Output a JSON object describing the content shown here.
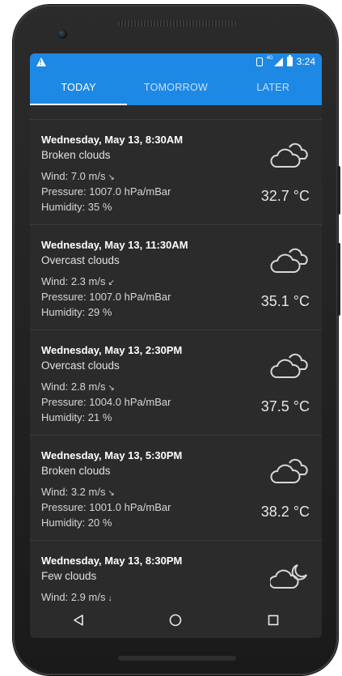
{
  "status": {
    "time": "3:24",
    "network": "4G"
  },
  "tabs": [
    {
      "label": "TODAY",
      "active": true
    },
    {
      "label": "TOMORROW",
      "active": false
    },
    {
      "label": "LATER",
      "active": false
    }
  ],
  "forecasts": [
    {
      "date": "Wednesday, May 13, 8:30AM",
      "description": "Broken clouds",
      "wind": "Wind: 7.0 m/s",
      "wind_dir": "↘",
      "pressure": "Pressure: 1007.0 hPa/mBar",
      "humidity": "Humidity: 35 %",
      "temperature": "32.7 °C",
      "icon": "broken-clouds-icon"
    },
    {
      "date": "Wednesday, May 13, 11:30AM",
      "description": "Overcast clouds",
      "wind": "Wind: 2.3 m/s",
      "wind_dir": "↙",
      "pressure": "Pressure: 1007.0 hPa/mBar",
      "humidity": "Humidity: 29 %",
      "temperature": "35.1 °C",
      "icon": "overcast-clouds-icon"
    },
    {
      "date": "Wednesday, May 13, 2:30PM",
      "description": "Overcast clouds",
      "wind": "Wind: 2.8 m/s",
      "wind_dir": "↘",
      "pressure": "Pressure: 1004.0 hPa/mBar",
      "humidity": "Humidity: 21 %",
      "temperature": "37.5 °C",
      "icon": "overcast-clouds-icon"
    },
    {
      "date": "Wednesday, May 13, 5:30PM",
      "description": "Broken clouds",
      "wind": "Wind: 3.2 m/s",
      "wind_dir": "↘",
      "pressure": "Pressure: 1001.0 hPa/mBar",
      "humidity": "Humidity: 20 %",
      "temperature": "38.2 °C",
      "icon": "broken-clouds-icon"
    },
    {
      "date": "Wednesday, May 13, 8:30PM",
      "description": "Few clouds",
      "wind": "Wind: 2.9 m/s",
      "wind_dir": "↓",
      "pressure": "",
      "humidity": "",
      "temperature": "",
      "icon": "few-clouds-night-icon"
    }
  ],
  "colors": {
    "accent": "#1e88e5",
    "background": "#2b2b2b"
  }
}
